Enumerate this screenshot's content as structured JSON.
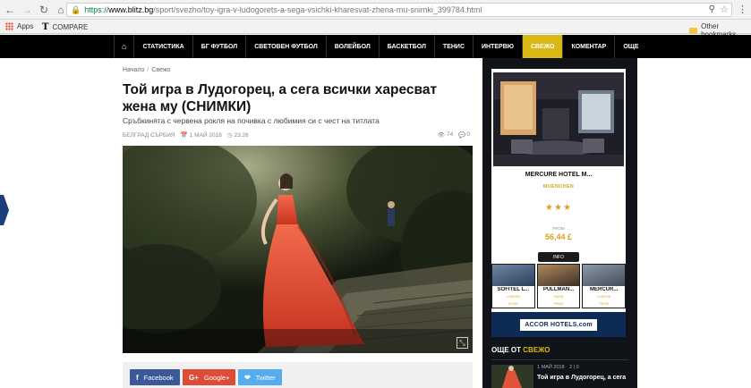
{
  "browser": {
    "url_scheme": "https://",
    "url_host": "www.blitz.bg",
    "url_path": "/sport/svezho/toy-igra-v-ludogorets-a-sega-vsichki-kharesvat-zhena-mu-snimki_399784.html",
    "bookmarks": [
      {
        "label": "Apps",
        "icon": "apps-grid-icon"
      },
      {
        "label": "COMPARE",
        "icon": "t-logo-icon"
      }
    ],
    "other_bookmarks": "Other bookmarks"
  },
  "nav": {
    "items": [
      {
        "label": "СТАТИСТИКА"
      },
      {
        "label": "БГ ФУТБОЛ"
      },
      {
        "label": "СВЕТОВЕН ФУТБОЛ"
      },
      {
        "label": "ВОЛЕЙБОЛ"
      },
      {
        "label": "БАСКЕТБОЛ"
      },
      {
        "label": "ТЕНИС"
      },
      {
        "label": "ИНТЕРВЮ"
      },
      {
        "label": "СВЕЖО"
      },
      {
        "label": "КОМЕНТАР"
      },
      {
        "label": "ОЩЕ"
      }
    ],
    "active_label": "СВЕЖО",
    "active_color": "#d9b815"
  },
  "article": {
    "breadcrumb": [
      "Начало",
      "Свежо"
    ],
    "breadcrumb_sep": "/",
    "title": "Той игра в Лудогорец, а сега всички харесват жена му (СНИМКИ)",
    "subtitle": "Сръбкинята с червена рокля на почивка с любимия си с чест на титлата",
    "author": "БЕЛГРАД СЪРБИЯ",
    "date": "1 МАЙ 2018",
    "time": "23:26",
    "views": "74",
    "comments": "0"
  },
  "share": {
    "facebook": "Facebook",
    "google": "Google+",
    "twitter": "Twitter"
  },
  "ad": {
    "hotel": "MERCURE HOTEL M...",
    "city": "MUENCHEN",
    "stars": "★★★",
    "from_label": "FROM",
    "price": "56,44 £",
    "info": "INFO",
    "thumbs": [
      {
        "name": "SOFITEL L...",
        "city": "LONDON",
        "from": "FROM"
      },
      {
        "name": "PULLMAN...",
        "city": "PARIS",
        "from": "FROM"
      },
      {
        "name": "MERCUR...",
        "city": "LONDON",
        "from": "FROM"
      }
    ],
    "brand": "ACCOR HOTELS.com"
  },
  "sidebar": {
    "more_prefix": "ОЩЕ ОТ",
    "more_section": "СВЕЖО",
    "item_date": "1 МАЙ 2018",
    "item_counts": "2 | 0",
    "item_title": "Той игра в Лудогорец, а сега"
  }
}
